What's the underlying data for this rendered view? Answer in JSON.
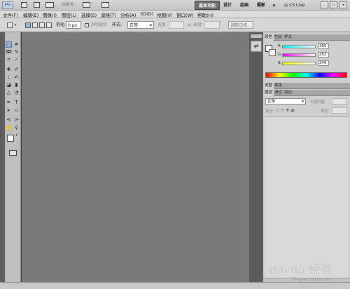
{
  "appbar": {
    "logo": "Ps",
    "zoom": "100%",
    "workspaces": [
      "基本功能",
      "设计",
      "绘画",
      "摄影"
    ],
    "more": "»",
    "cs_live": "CS Live"
  },
  "menu": [
    "文件(F)",
    "编辑(E)",
    "图像(I)",
    "图层(L)",
    "选择(S)",
    "滤镜(T)",
    "分析(A)",
    "3D(D)",
    "视图(V)",
    "窗口(W)",
    "帮助(H)"
  ],
  "options": {
    "feather_label": "羽化:",
    "feather_value": "0 px",
    "antialias_label": "消除锯齿",
    "style_label": "样式:",
    "style_value": "正常",
    "width_label": "宽度:",
    "height_label": "高度:",
    "refine_button": "调整边缘..."
  },
  "color_panel": {
    "tabs": [
      "颜色",
      "色板",
      "样式"
    ],
    "r_label": "R",
    "r_value": 250,
    "g_label": "G",
    "g_value": 252,
    "b_label": "B",
    "b_value": 249
  },
  "adjust_panel": {
    "tabs": [
      "调整",
      "蒙版"
    ]
  },
  "layers_panel": {
    "tabs": [
      "图层",
      "通道",
      "路径"
    ],
    "blend_mode": "正常",
    "opacity_label": "不透明度:",
    "lock_label": "锁定:",
    "fill_label": "填充:"
  },
  "watermark": {
    "main": "Bai du 经验",
    "sub": "jingyan.baidu.com"
  },
  "colors": {
    "canvas": "#7a7a7a",
    "panel": "#cfcfcf",
    "active_workspace": "#6f6f6f"
  }
}
